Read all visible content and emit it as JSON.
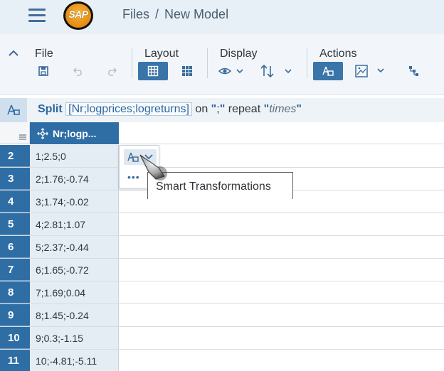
{
  "shell": {
    "logo_text": "SAP",
    "breadcrumb": [
      "Files",
      "New Model"
    ],
    "breadcrumb_sep": "/"
  },
  "toolbar": {
    "groups": {
      "file": "File",
      "layout": "Layout",
      "display": "Display",
      "actions": "Actions"
    }
  },
  "transform_bar": {
    "action": "Split",
    "column": "[Nr;logprices;logreturns]",
    "on_word": "on",
    "delimiter_open": "\"",
    "delimiter": ";",
    "delimiter_close": "\"",
    "repeat_word": "repeat",
    "times_open": "\"",
    "times_word": "times",
    "times_close": "\""
  },
  "grid": {
    "column_header": "Nr;logp...",
    "rows": [
      {
        "num": "2",
        "value": "1;2.5;0"
      },
      {
        "num": "3",
        "value": "2;1.76;-0.74"
      },
      {
        "num": "4",
        "value": "3;1.74;-0.02"
      },
      {
        "num": "5",
        "value": "4;2.81;1.07"
      },
      {
        "num": "6",
        "value": "5;2.37;-0.44"
      },
      {
        "num": "7",
        "value": "6;1.65;-0.72"
      },
      {
        "num": "8",
        "value": "7;1.69;0.04"
      },
      {
        "num": "9",
        "value": "8;1.45;-0.24"
      },
      {
        "num": "10",
        "value": "9;0.3;-1.15"
      },
      {
        "num": "11",
        "value": "10;-4.81;-5.11"
      }
    ]
  },
  "popover": {
    "more": "•••",
    "tooltip": "Smart Transformations"
  },
  "colors": {
    "accent": "#2f6ea5",
    "shell_bg": "#e8f0f7",
    "cell_bg": "#e4ecf4"
  },
  "icons": [
    "menu-icon",
    "save-icon",
    "undo-icon",
    "redo-icon",
    "grid-view-icon",
    "card-view-icon",
    "eye-icon",
    "sort-icon",
    "smart-transform-icon",
    "image-icon",
    "hierarchy-icon",
    "chevron-up-icon",
    "chevron-down-icon"
  ]
}
